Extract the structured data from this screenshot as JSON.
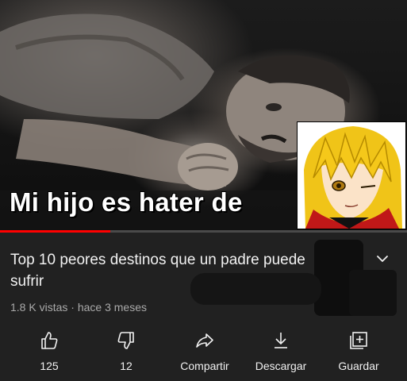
{
  "video": {
    "caption": "Mi hijo es hater de",
    "progress": 0.27,
    "progress_color": "#ff0000"
  },
  "info": {
    "title": "Top 10 peores destinos que un padre puede sufrir",
    "views": "1.8 K vistas",
    "separator": "·",
    "age": "hace 3 meses"
  },
  "actions": [
    {
      "icon": "thumbs-up-icon",
      "label": "125"
    },
    {
      "icon": "thumbs-down-icon",
      "label": "12"
    },
    {
      "icon": "share-icon",
      "label": "Compartir"
    },
    {
      "icon": "download-icon",
      "label": "Descargar"
    },
    {
      "icon": "save-icon",
      "label": "Guardar"
    }
  ],
  "colors": {
    "background": "#212121",
    "text": "#f1f1f1",
    "secondary_text": "#aaaaaa",
    "accent": "#ff0000"
  }
}
